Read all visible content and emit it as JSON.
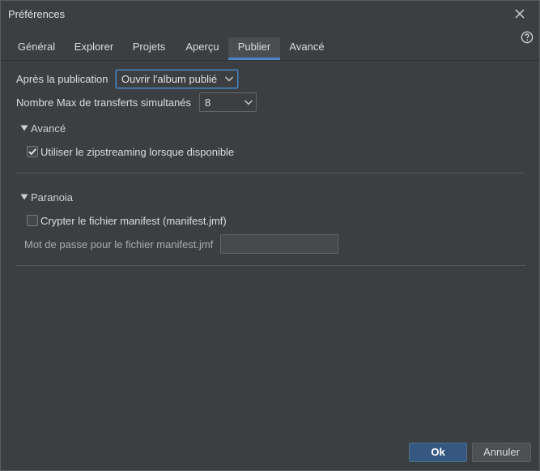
{
  "window": {
    "title": "Préférences"
  },
  "icons": {
    "close": "close-icon",
    "help": "help-icon"
  },
  "tabs": [
    {
      "label": "Général"
    },
    {
      "label": "Explorer"
    },
    {
      "label": "Projets"
    },
    {
      "label": "Aperçu"
    },
    {
      "label": "Publier",
      "active": true
    },
    {
      "label": "Avancé"
    }
  ],
  "publish": {
    "after_label": "Après la publication",
    "after_value": "Ouvrir l'album publié",
    "max_transfers_label": "Nombre Max de transferts simultanés",
    "max_transfers_value": "8"
  },
  "advanced": {
    "header": "Avancé",
    "zipstreaming_label": "Utiliser le  zipstreaming lorsque disponible",
    "zipstreaming_checked": true
  },
  "paranoia": {
    "header": "Paranoia",
    "encrypt_label": "Crypter le fichier manifest  (manifest.jmf)",
    "encrypt_checked": false,
    "password_label": "Mot de passe pour le fichier manifest.jmf",
    "password_value": ""
  },
  "buttons": {
    "ok": "Ok",
    "cancel": "Annuler"
  },
  "colors": {
    "accent": "#4a88c7",
    "background": "#3c3f41",
    "primary_button": "#365880"
  }
}
